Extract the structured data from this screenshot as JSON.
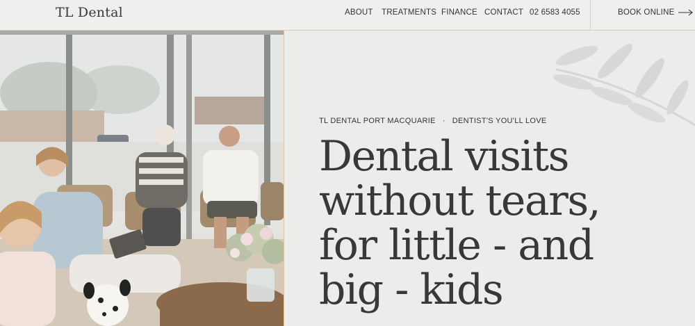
{
  "header": {
    "logo": "TL Dental",
    "nav": [
      "ABOUT",
      "TREATMENTS",
      "FINANCE",
      "CONTACT",
      "02 6583 4055"
    ],
    "book_online": "BOOK ONLINE"
  },
  "hero": {
    "eyebrow_left": "TL DENTAL PORT MACQUARIE",
    "eyebrow_separator": "·",
    "eyebrow_right": "DENTIST'S YOU'LL LOVE",
    "headline_lines": [
      "Dental visits",
      "without tears,",
      "for little - and",
      "big - kids"
    ]
  },
  "colors": {
    "background": "#ececeb",
    "accent_line": "#d8cdb6",
    "text": "#383838"
  }
}
